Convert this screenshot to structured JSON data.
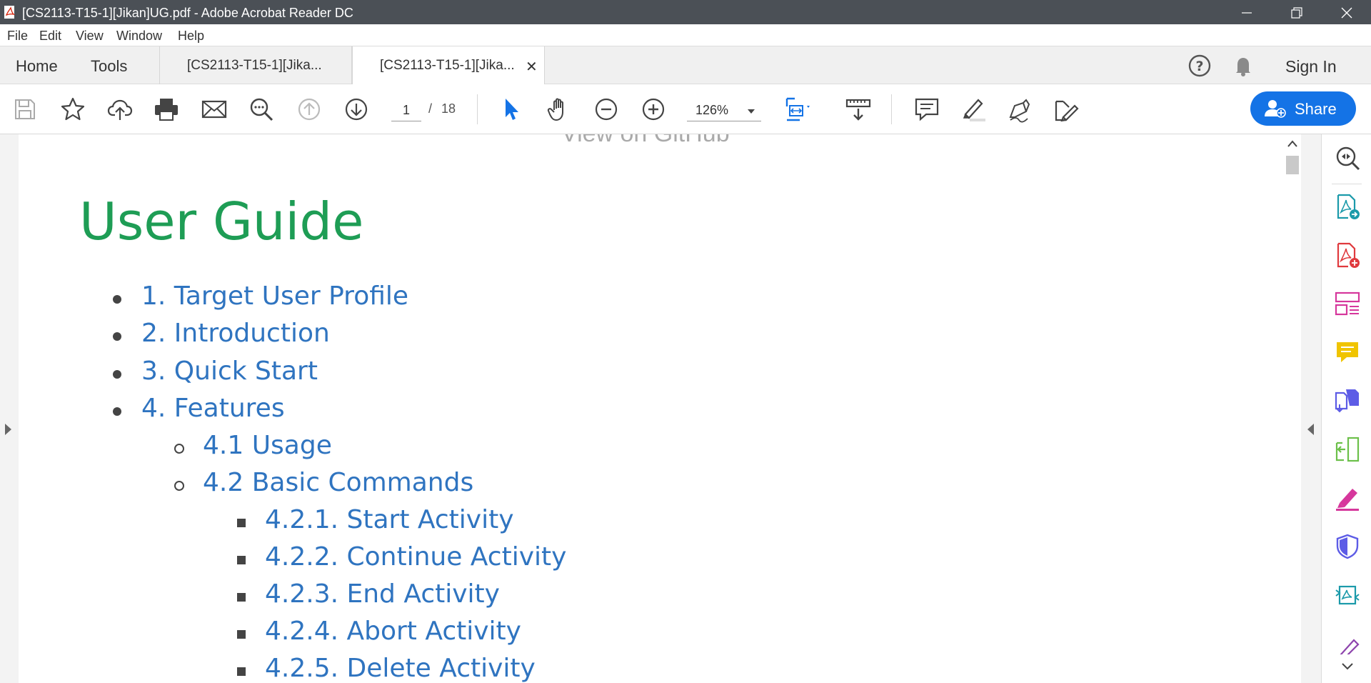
{
  "window": {
    "title": "[CS2113-T15-1][Jikan]UG.pdf - Adobe Acrobat Reader DC"
  },
  "menu": [
    "File",
    "Edit",
    "View",
    "Window",
    "Help"
  ],
  "tabs": {
    "home": "Home",
    "tools": "Tools",
    "doc_tabs": [
      "[CS2113-T15-1][Jika...",
      "[CS2113-T15-1][Jika..."
    ],
    "close_glyph": "✕",
    "sign_in": "Sign In"
  },
  "toolbar": {
    "current_page": "1",
    "page_separator": "/",
    "total_pages": "18",
    "zoom": "126%",
    "share_label": "Share"
  },
  "document": {
    "header_remnant": "View on GitHub",
    "heading": "User Guide",
    "toc": [
      {
        "text": "1. Target User Profile",
        "level": 1
      },
      {
        "text": "2. Introduction",
        "level": 1
      },
      {
        "text": "3. Quick Start",
        "level": 1
      },
      {
        "text": "4. Features",
        "level": 1
      },
      {
        "text": "4.1 Usage",
        "level": 2
      },
      {
        "text": "4.2 Basic Commands",
        "level": 2
      },
      {
        "text": "4.2.1. Start Activity",
        "level": 3
      },
      {
        "text": "4.2.2. Continue Activity",
        "level": 3
      },
      {
        "text": "4.2.3. End Activity",
        "level": 3
      },
      {
        "text": "4.2.4. Abort Activity",
        "level": 3
      },
      {
        "text": "4.2.5. Delete Activity",
        "level": 3
      }
    ]
  },
  "colors": {
    "heading": "#1e9d55",
    "link": "#2f74c0",
    "share": "#1473e6",
    "titlebar": "#4b5056"
  },
  "icons": {
    "toolbar": [
      "save-icon",
      "bookmark-star-icon",
      "cloud-upload-icon",
      "print-icon",
      "email-icon",
      "search-icon",
      "page-up-icon",
      "page-down-icon",
      "select-cursor-icon",
      "hand-icon",
      "zoom-out-icon",
      "zoom-in-icon",
      "fit-page-icon",
      "scroll-mode-icon",
      "comment-icon",
      "highlight-icon",
      "sign-icon",
      "edit-fill-icon"
    ],
    "tools_pane": [
      "search-zoom-icon",
      "export-pdf-icon",
      "create-pdf-icon",
      "organize-pages-icon",
      "comment-icon",
      "combine-files-icon",
      "compress-icon",
      "fill-sign-icon",
      "protect-icon",
      "send-for-review-icon",
      "more-tools-icon"
    ]
  }
}
